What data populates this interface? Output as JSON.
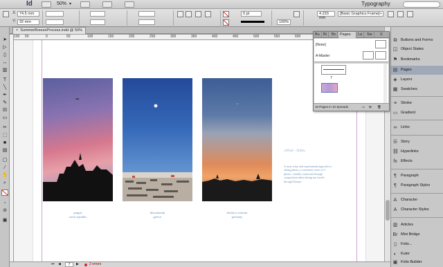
{
  "app": {
    "logo": "Id",
    "zoom": "50%",
    "workspace": "Typography"
  },
  "control": {
    "x_label": "X:",
    "x_value": "74.5 mm",
    "y_label": "Y:",
    "y_value": "32 mm",
    "stroke_weight": "0 pt",
    "percent": "100%",
    "width_value": "4.233 mm",
    "frame_style": "[Basic Graphics Frame]+"
  },
  "document": {
    "tab_title": "SummerBreezeProcess.indd @ 50%",
    "close_glyph": "×"
  },
  "ruler_ticks": [
    "100",
    "50",
    "0",
    "50",
    "100",
    "150",
    "200",
    "250",
    "300",
    "350",
    "400",
    "450",
    "500",
    "550",
    "600",
    "650",
    "700",
    "750"
  ],
  "captions": [
    {
      "line1": "prague",
      "line2": "czech republic"
    },
    {
      "line1": "thessaloniki",
      "line2": "greece"
    },
    {
      "line1": "berlin to weimar",
      "line2": "germany"
    }
  ],
  "wind": {
    "title": "«Wind – Stille»",
    "body": "A more risky and experimental approach to taking photos, a consistent series of 3 photos, visually connected through composition taken during my travels through Europe."
  },
  "pages_panel": {
    "tabs": [
      "Bu",
      "Bi",
      "Bc",
      "Pages",
      "La",
      "Sw"
    ],
    "masters": [
      "[None]",
      "A-Master"
    ],
    "page_number": "7",
    "footer": "10 Pages in 10 Spreads"
  },
  "dock": {
    "items": [
      {
        "icon": "⧉",
        "label": "Buttons and Forms"
      },
      {
        "icon": "◫",
        "label": "Object States"
      },
      {
        "icon": "⚑",
        "label": "Bookmarks"
      },
      {
        "icon": "▤",
        "label": "Pages"
      },
      {
        "icon": "◈",
        "label": "Layers"
      },
      {
        "icon": "▦",
        "label": "Swatches"
      },
      {
        "icon": "≡",
        "label": "Stroke"
      },
      {
        "icon": "▭",
        "label": "Gradient"
      },
      {
        "icon": "∞",
        "label": "Links"
      },
      {
        "icon": "☰",
        "label": "Story"
      },
      {
        "icon": "⛓",
        "label": "Hyperlinks"
      },
      {
        "icon": "fx",
        "label": "Effects"
      },
      {
        "icon": "¶",
        "label": "Paragraph"
      },
      {
        "icon": "¶",
        "label": "Paragraph Styles"
      },
      {
        "icon": "A",
        "label": "Character"
      },
      {
        "icon": "A",
        "label": "Character Styles"
      },
      {
        "icon": "▥",
        "label": "Articles"
      },
      {
        "icon": "Br",
        "label": "Mini Bridge"
      },
      {
        "icon": "▯",
        "label": "Folio..."
      },
      {
        "icon": "◐",
        "label": "Kuler"
      },
      {
        "icon": "▣",
        "label": "Folio Builder"
      }
    ]
  },
  "status": {
    "page_field": "7",
    "errors": "2 errors"
  }
}
